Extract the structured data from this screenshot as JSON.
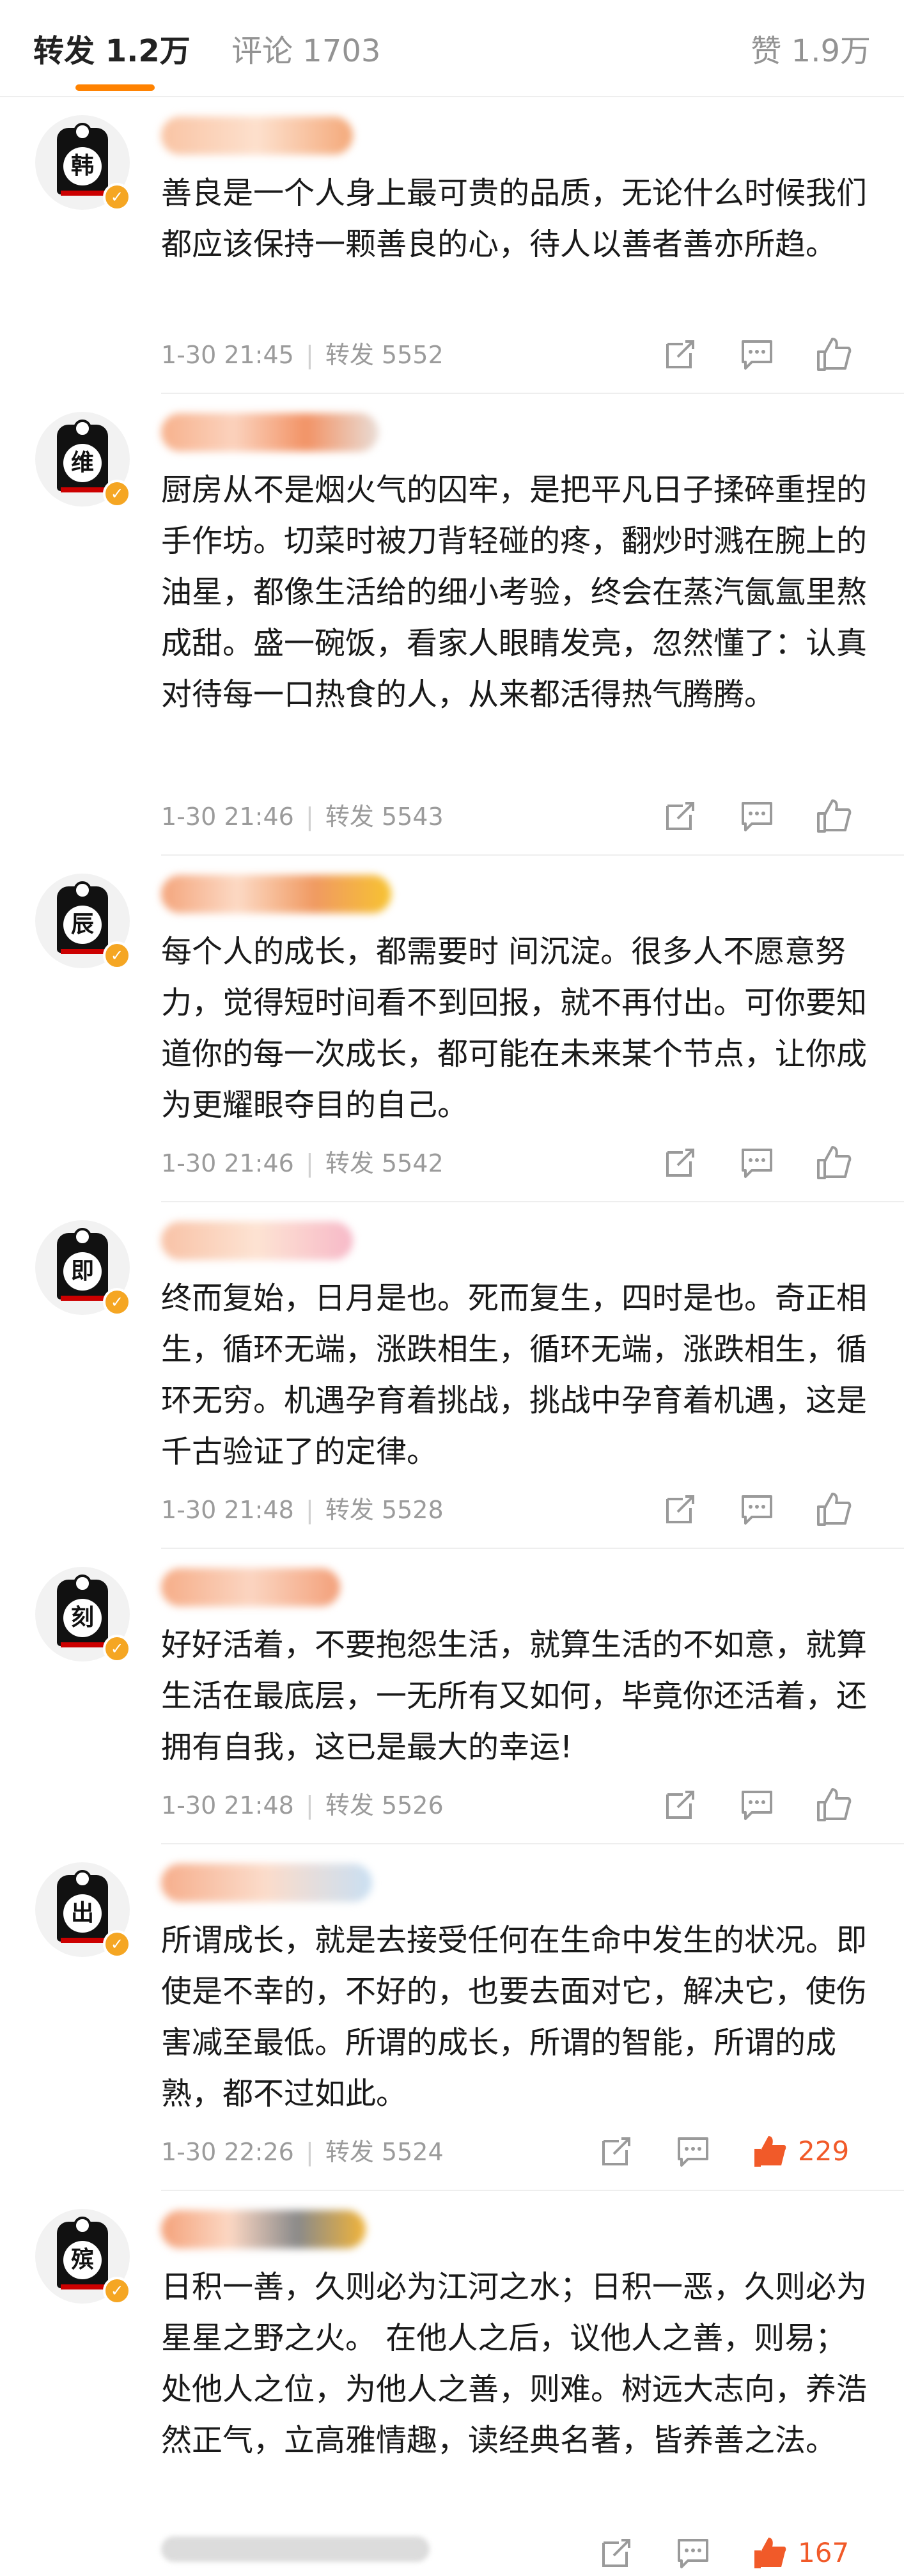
{
  "tabs": {
    "repost_label": "转发",
    "repost_count": "1.2万",
    "comment_label": "评论",
    "comment_count": "1703",
    "like_label": "赞",
    "like_count": "1.9万"
  },
  "colors": {
    "accent": "#ff8200",
    "meta_text": "#9b9b9b",
    "badge": "#f5a623",
    "like_active": "#f15a29"
  },
  "comments": [
    {
      "avatar_char": "韩",
      "text": "善良是一个人身上最可贵的品质，无论什么时候我们都应该保持一颗善良的心，待人以善者善亦所趋。",
      "time": "1-30 21:45",
      "repost": "转发 5552",
      "likes": "",
      "liked": false
    },
    {
      "avatar_char": "维",
      "text": "厨房从不是烟火气的囚牢，是把平凡日子揉碎重捏的手作坊。切菜时被刀背轻碰的疼，翻炒时溅在腕上的油星，都像生活给的细小考验，终会在蒸汽氤氲里熬成甜。盛一碗饭，看家人眼睛发亮，忽然懂了：认真对待每一口热食的人，从来都活得热气腾腾。",
      "time": "1-30 21:46",
      "repost": "转发 5543",
      "likes": "",
      "liked": false
    },
    {
      "avatar_char": "辰",
      "text": "每个人的成长，都需要时 间沉淀。很多人不愿意努力，觉得短时间看不到回报，就不再付出。可你要知道你的每一次成长，都可能在未来某个节点，让你成为更耀眼夺目的自己。",
      "time": "1-30 21:46",
      "repost": "转发 5542",
      "likes": "",
      "liked": false
    },
    {
      "avatar_char": "即",
      "text": "终而复始，日月是也。死而复生，四时是也。奇正相生，循环无端，涨跌相生，循环无端，涨跌相生，循环无穷。机遇孕育着挑战，挑战中孕育着机遇，这是千古验证了的定律。",
      "time": "1-30 21:48",
      "repost": "转发 5528",
      "likes": "",
      "liked": false
    },
    {
      "avatar_char": "刻",
      "text": "好好活着，不要抱怨生活，就算生活的不如意，就算生活在最底层，一无所有又如何，毕竟你还活着，还拥有自我，这已是最大的幸运!",
      "time": "1-30 21:48",
      "repost": "转发 5526",
      "likes": "",
      "liked": false
    },
    {
      "avatar_char": "出",
      "text": "所谓成长，就是去接受任何在生命中发生的状况。即使是不幸的，不好的，也要去面对它，解决它，使伤害减至最低。所谓的成长，所谓的智能，所谓的成熟，都不过如此。",
      "time": "1-30 22:26",
      "repost": "转发 5524",
      "likes": "229",
      "liked": true
    },
    {
      "avatar_char": "殡",
      "text": "日积一善，久则必为江河之水；日积一恶，久则必为星星之野之火。 在他人之后，议他人之善，则易；处他人之位，为他人之善，则难。树远大志向，养浩然正气，立高雅情趣，读经典名著，皆养善之法。",
      "time": "",
      "repost": "",
      "likes": "167",
      "liked": true
    }
  ]
}
